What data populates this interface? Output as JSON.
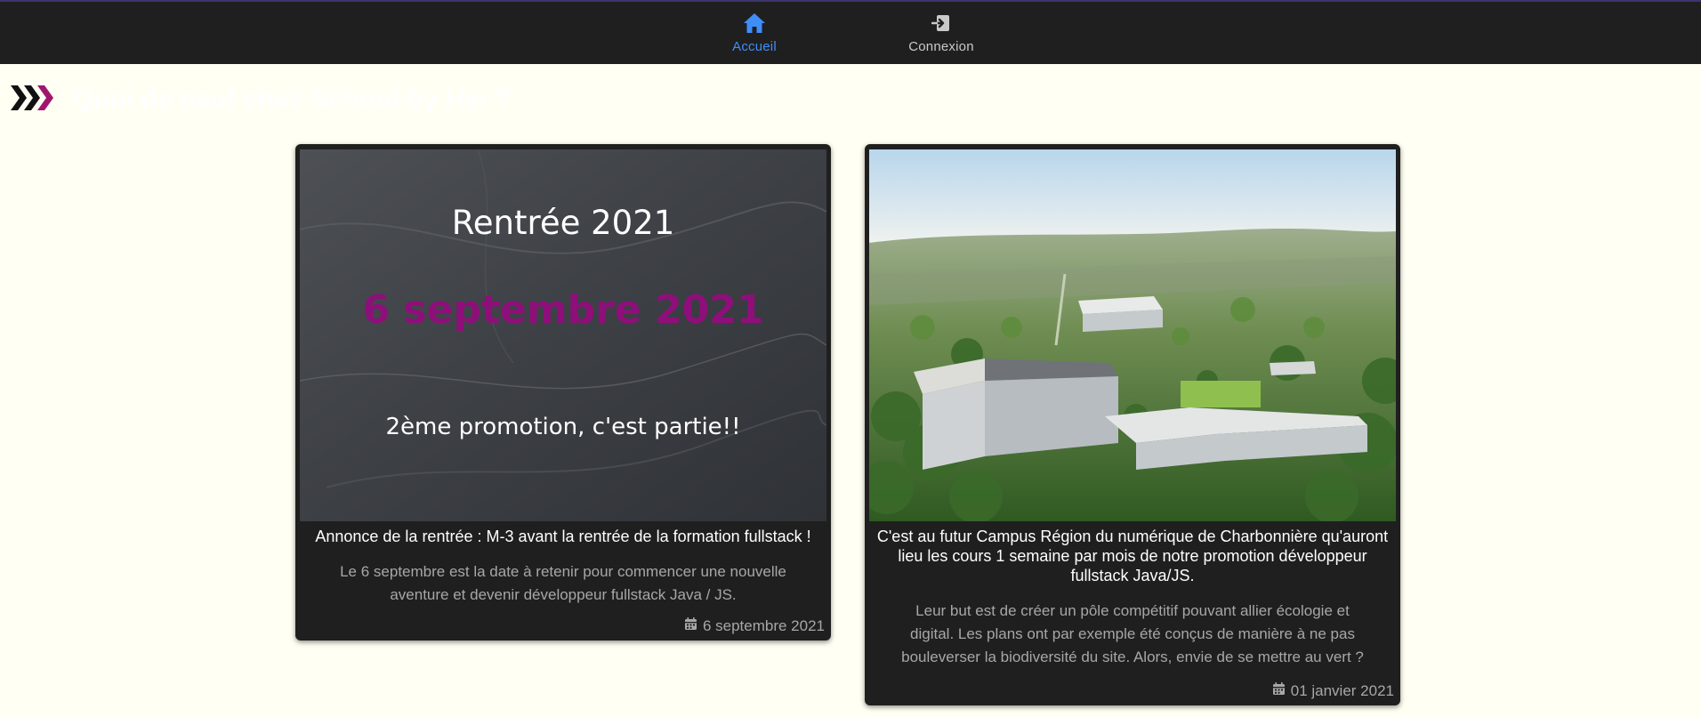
{
  "nav": {
    "home": {
      "label": "Accueil",
      "icon": "home-icon",
      "color": "#3f8ef7"
    },
    "login": {
      "label": "Connexion",
      "icon": "login-icon"
    }
  },
  "page": {
    "title": "Quoi de neuf chez School by Hei ?"
  },
  "cards": [
    {
      "image": {
        "line1": "Rentrée 2021",
        "line2": "6 septembre 2021",
        "line3": "2ème promotion, c'est partie!!",
        "accent": "#8e0f7a"
      },
      "title": "Annonce de la rentrée : M-3 avant la rentrée de la formation fullstack !",
      "text": "Le 6 septembre est la date à retenir pour commencer une nouvelle aventure et devenir développeur fullstack Java / JS.",
      "date": "6 septembre 2021"
    },
    {
      "title": "C'est au futur Campus Région du numérique de Charbonnière qu'auront lieu les cours 1 semaine par mois de notre promotion développeur fullstack Java/JS.",
      "text": "Leur but est de créer un pôle compétitif pouvant allier écologie et digital. Les plans ont par exemple été conçus de manière à ne pas bouleverser la biodiversité du site. Alors, envie de se mettre au vert ?",
      "date": "01 janvier 2021"
    }
  ]
}
